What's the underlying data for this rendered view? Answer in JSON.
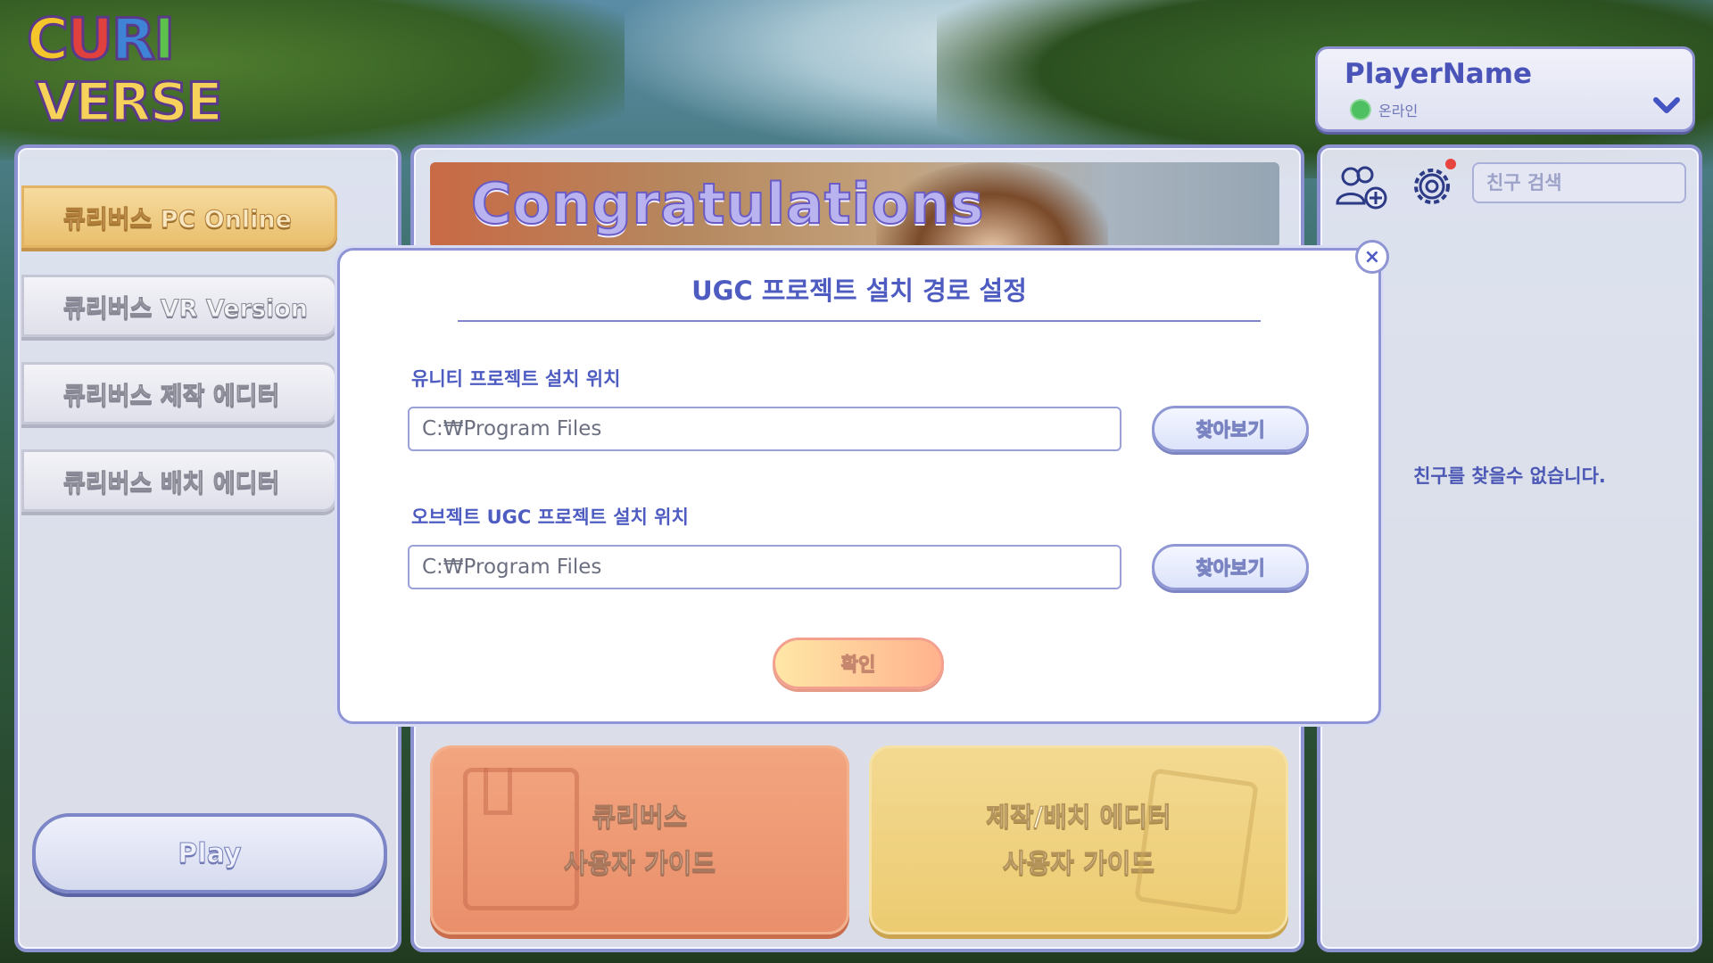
{
  "logo": {
    "line1": [
      "C",
      "U",
      "R",
      "I"
    ],
    "line2": "VERSE"
  },
  "profile": {
    "name": "PlayerName",
    "status": "온라인",
    "status_color": "#4fc061"
  },
  "left_menu": {
    "items": [
      {
        "label": "큐리버스 PC Online",
        "active": true
      },
      {
        "label": "큐리버스 VR Version",
        "active": false
      },
      {
        "label": "큐리버스 제작 에디터",
        "active": false
      },
      {
        "label": "큐리버스 배치 에디터",
        "active": false
      }
    ],
    "play_label": "Play"
  },
  "banner": {
    "text": "Congratulations"
  },
  "guides": {
    "user": {
      "line1": "큐리버스",
      "line2": "사용자 가이드"
    },
    "editor": {
      "line1": "제작/배치 에디터",
      "line2": "사용자 가이드"
    }
  },
  "friends": {
    "search_placeholder": "친구 검색",
    "empty_message": "친구를 찾을수 없습니다.",
    "add_icon": "add-friend-icon",
    "settings_icon": "gear-icon"
  },
  "modal": {
    "title": "UGC 프로젝트 설치 경로 설정",
    "unity_label": "유니티 프로젝트 설치 위치",
    "unity_path": "C:₩Program Files",
    "object_label": "오브젝트 UGC 프로젝트 설치 위치",
    "object_path": "C:₩Program Files",
    "browse_label": "찾아보기",
    "confirm_label": "확인",
    "close_icon": "close-icon"
  },
  "colors": {
    "accent": "#4e5cc2",
    "border": "#8e94d4",
    "active_menu": "#e9bf6c"
  }
}
